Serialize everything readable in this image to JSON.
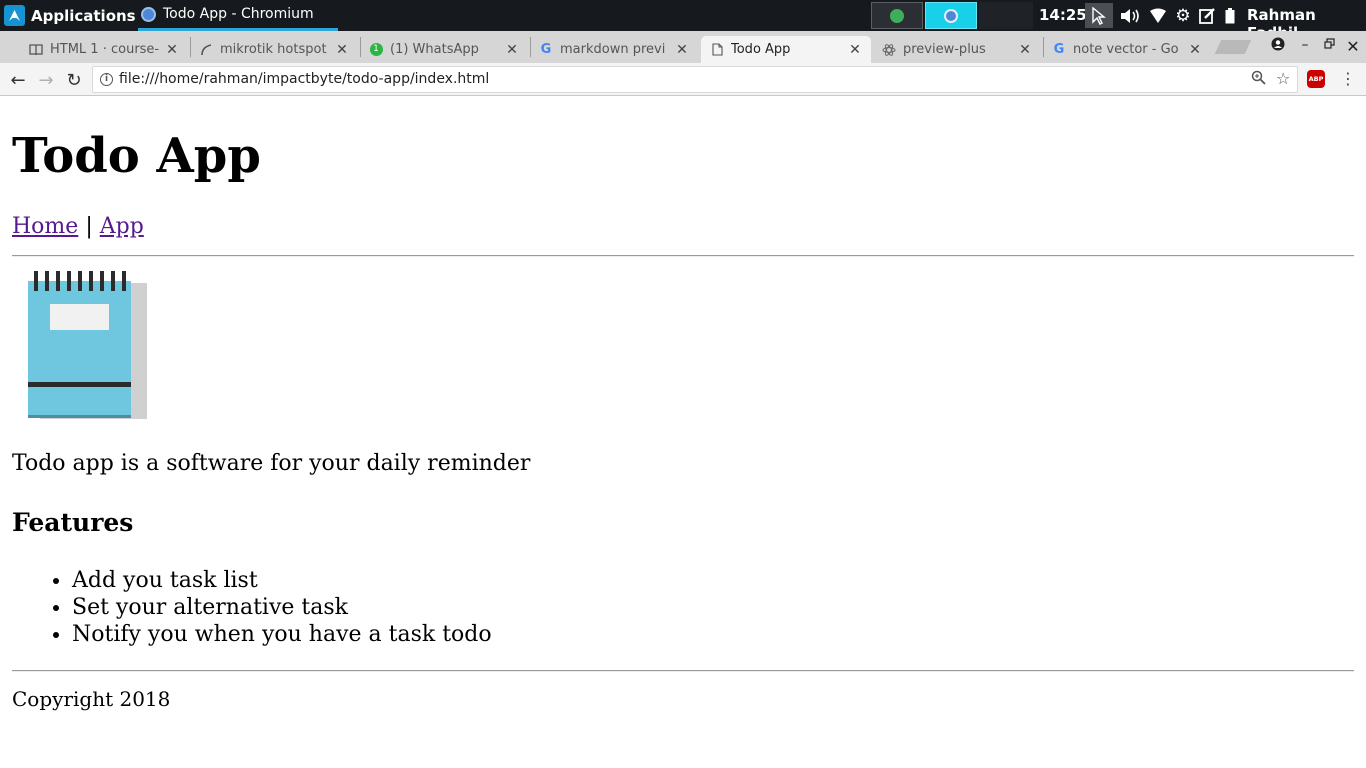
{
  "system_panel": {
    "applications_label": "Applications",
    "active_task": "Todo App - Chromium",
    "clock": "14:25",
    "user_name": "Rahman Fadhil"
  },
  "browser": {
    "tabs": [
      {
        "title": "HTML 1 · course-",
        "icon": "book-icon"
      },
      {
        "title": "mikrotik hotspot",
        "icon": "mikrotik-icon"
      },
      {
        "title": "(1) WhatsApp",
        "icon": "whatsapp-icon"
      },
      {
        "title": "markdown previ",
        "icon": "google-icon"
      },
      {
        "title": "Todo App",
        "icon": "page-icon",
        "active": true
      },
      {
        "title": "preview-plus",
        "icon": "atom-icon"
      },
      {
        "title": "note vector - Go",
        "icon": "google-icon"
      }
    ],
    "url": "file:///home/rahman/impactbyte/todo-app/index.html",
    "extension_badge": "ABP"
  },
  "page": {
    "title": "Todo App",
    "nav": {
      "home": "Home",
      "separator": "|",
      "app": "App"
    },
    "description": "Todo app is a software for your daily reminder",
    "features_heading": "Features",
    "features": [
      "Add you task list",
      "Set your alternative task",
      "Notify you when you have a task todo"
    ],
    "copyright": "Copyright 2018"
  },
  "colors": {
    "panel_bg": "#16191d",
    "workspace_active": "#18d0ea",
    "link_visited": "#551a8b",
    "notepad_cover": "#6ec6df",
    "notepad_shadow": "#d0d0d0",
    "notepad_binding": "#2b2b2b"
  }
}
